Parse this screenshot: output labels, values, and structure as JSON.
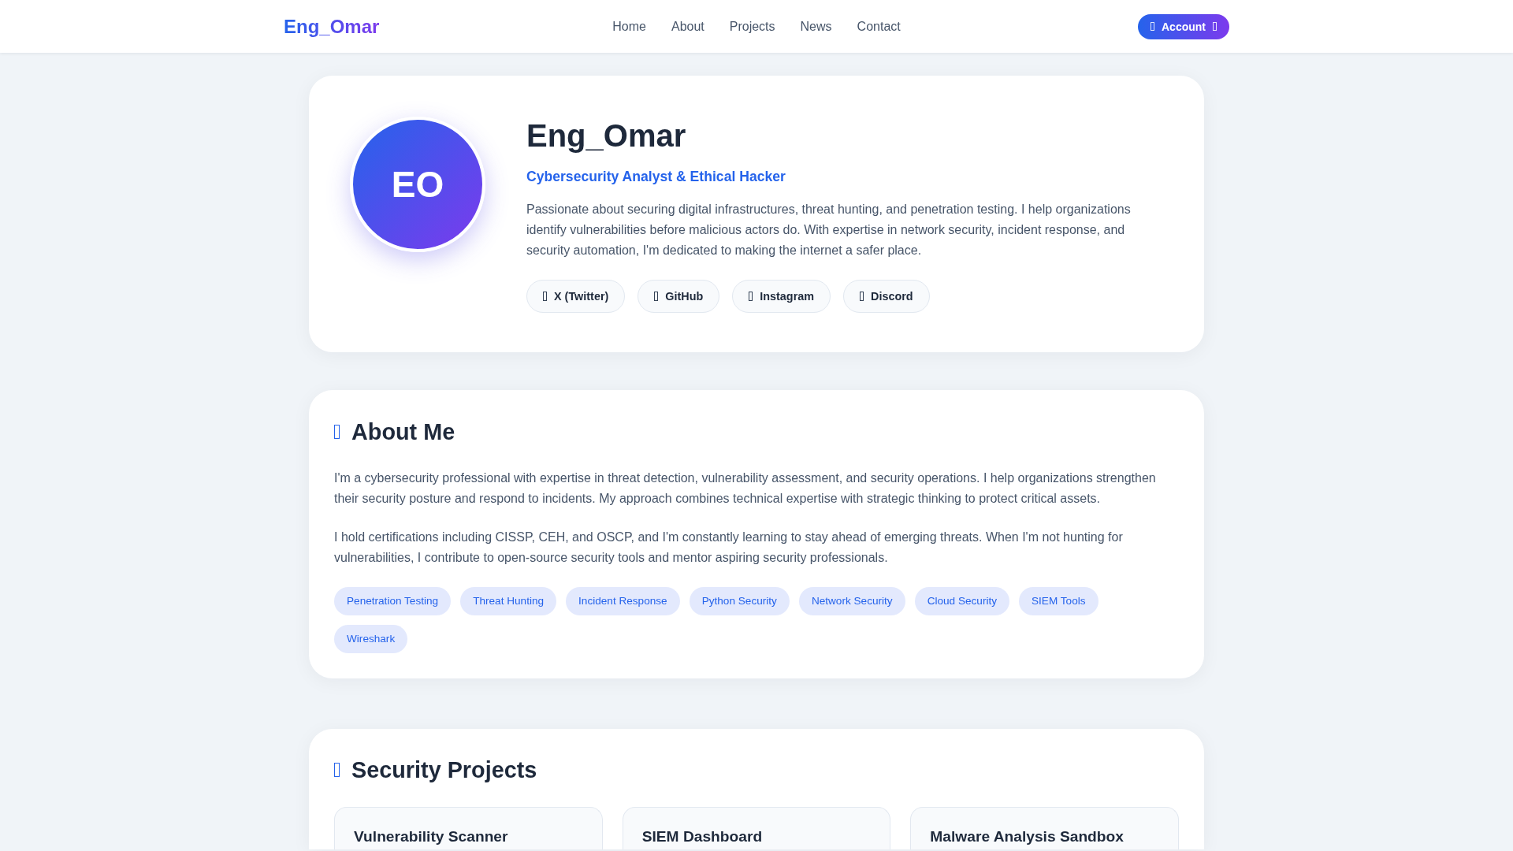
{
  "navbar": {
    "logo": "Eng_Omar",
    "links": [
      "Home",
      "About",
      "Projects",
      "News",
      "Contact"
    ],
    "account_button": "Account"
  },
  "profile": {
    "initials": "EO",
    "name": "Eng_Omar",
    "title": "Cybersecurity Analyst & Ethical Hacker",
    "bio": "Passionate about securing digital infrastructures, threat hunting, and penetration testing. I help organizations identify vulnerabilities before malicious actors do. With expertise in network security, incident response, and security automation, I'm dedicated to making the internet a safer place.",
    "social_links": [
      "X (Twitter)",
      "GitHub",
      "Instagram",
      "Discord"
    ]
  },
  "about": {
    "heading": "About Me",
    "paragraphs": [
      "I'm a cybersecurity professional with expertise in threat detection, vulnerability assessment, and security operations. I help organizations strengthen their security posture and respond to incidents. My approach combines technical expertise with strategic thinking to protect critical assets.",
      "I hold certifications including CISSP, CEH, and OSCP, and I'm constantly learning to stay ahead of emerging threats. When I'm not hunting for vulnerabilities, I contribute to open-source security tools and mentor aspiring security professionals."
    ],
    "skills": [
      "Penetration Testing",
      "Threat Hunting",
      "Incident Response",
      "Python Security",
      "Network Security",
      "Cloud Security",
      "SIEM Tools",
      "Wireshark"
    ]
  },
  "projects": {
    "heading": "Security Projects",
    "items": [
      {
        "title": "Vulnerability Scanner"
      },
      {
        "title": "SIEM Dashboard"
      },
      {
        "title": "Malware Analysis Sandbox"
      }
    ]
  }
}
